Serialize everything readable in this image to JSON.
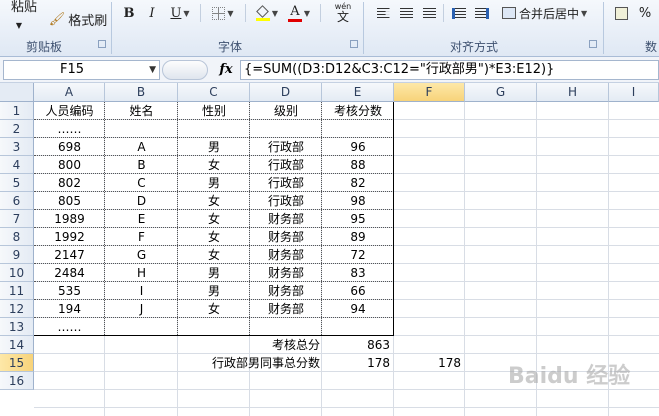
{
  "ribbon": {
    "paste_label": "粘贴",
    "format_painter_label": "格式刷",
    "clipboard_group": "剪贴板",
    "font_group": "字体",
    "align_group": "对齐方式",
    "number_group": "数",
    "bold": "B",
    "italic": "I",
    "underline": "U",
    "merge_center": "合并后居中",
    "percent": "%",
    "wen_label": "wén",
    "wen_char": "文"
  },
  "formula_bar": {
    "name_box": "F15",
    "fx": "fx",
    "formula": "{=SUM((D3:D12&C3:C12=\"行政部男\")*E3:E12)}"
  },
  "columns": [
    "A",
    "B",
    "C",
    "D",
    "E",
    "F",
    "G",
    "H",
    "I"
  ],
  "rows": [
    "1",
    "2",
    "3",
    "4",
    "5",
    "6",
    "7",
    "8",
    "9",
    "10",
    "11",
    "12",
    "13",
    "14",
    "15",
    "16"
  ],
  "table": {
    "headers": [
      "人员编码",
      "姓名",
      "性别",
      "级别",
      "考核分数"
    ],
    "ellipsis": "……",
    "data": [
      [
        "698",
        "A",
        "男",
        "行政部",
        "96"
      ],
      [
        "800",
        "B",
        "女",
        "行政部",
        "88"
      ],
      [
        "802",
        "C",
        "男",
        "行政部",
        "82"
      ],
      [
        "805",
        "D",
        "女",
        "行政部",
        "98"
      ],
      [
        "1989",
        "E",
        "女",
        "财务部",
        "95"
      ],
      [
        "1992",
        "F",
        "女",
        "财务部",
        "89"
      ],
      [
        "2147",
        "G",
        "女",
        "财务部",
        "72"
      ],
      [
        "2484",
        "H",
        "男",
        "财务部",
        "83"
      ],
      [
        "535",
        "I",
        "男",
        "财务部",
        "66"
      ],
      [
        "194",
        "J",
        "女",
        "财务部",
        "94"
      ]
    ]
  },
  "summary": {
    "total_label": "考核总分",
    "total_value": "863",
    "admin_male_label": "行政部男同事总分数",
    "admin_male_value": "178",
    "f15_value": "178"
  },
  "watermark": "Baidu 经验"
}
